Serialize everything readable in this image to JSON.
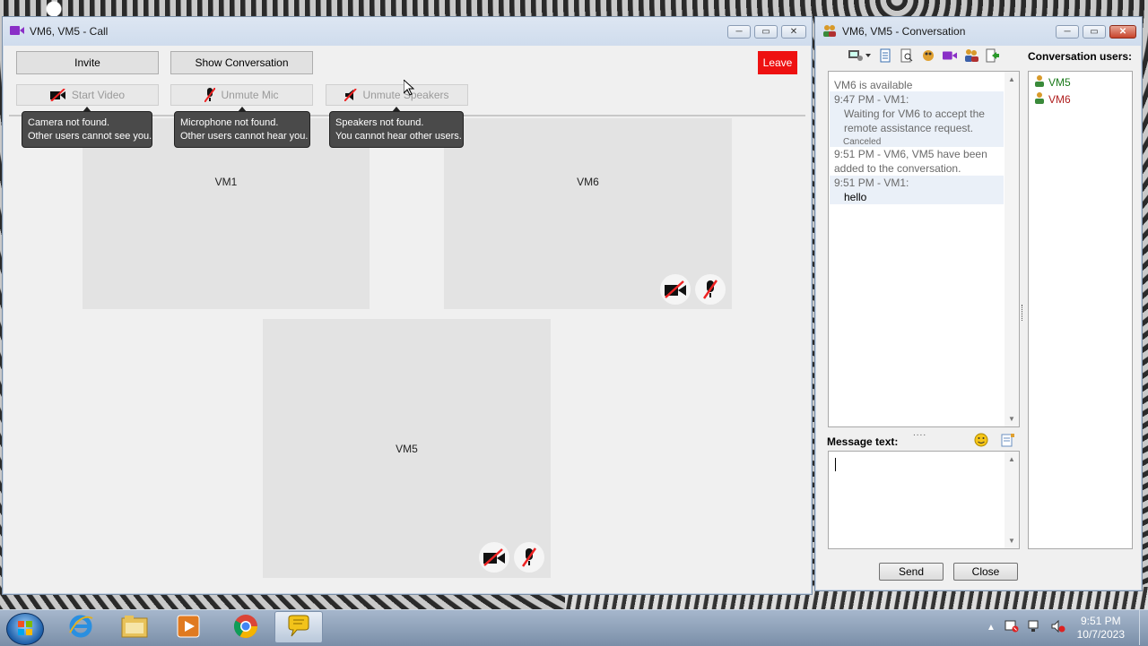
{
  "call_window": {
    "title": "VM6, VM5 - Call",
    "buttons": {
      "invite": "Invite",
      "show_conversation": "Show Conversation",
      "leave": "Leave",
      "start_video": "Start Video",
      "unmute_mic": "Unmute Mic",
      "unmute_speakers": "Unmute Speakers"
    },
    "tooltips": {
      "camera": [
        "Camera not found.",
        "Other users cannot see you."
      ],
      "microphone": [
        "Microphone not found.",
        "Other users cannot hear you."
      ],
      "speakers": [
        "Speakers not found.",
        "You cannot hear other users."
      ]
    },
    "participants": [
      {
        "name": "VM1",
        "show_status_icons": false
      },
      {
        "name": "VM6",
        "show_status_icons": true
      },
      {
        "name": "VM5",
        "show_status_icons": true
      }
    ]
  },
  "conversation_window": {
    "title": "VM6, VM5 - Conversation",
    "users_header": "Conversation users:",
    "users": [
      {
        "name": "VM5",
        "color": "#1a7a1a"
      },
      {
        "name": "VM6",
        "color": "#b02020"
      }
    ],
    "messages": {
      "m1": "VM6 is available",
      "m2_header": "9:47 PM - VM1:",
      "m2_body_1": "Waiting for VM6 to accept the",
      "m2_body_2": "remote assistance request.",
      "m2_status": "Canceled",
      "m3_1": "9:51 PM - VM6, VM5 have been",
      "m3_2": "added to the conversation.",
      "m4_header": "9:51 PM - VM1:",
      "m4_body": "hello"
    },
    "message_label": "Message text:",
    "message_value": "",
    "send": "Send",
    "close": "Close"
  },
  "taskbar": {
    "time": "9:51 PM",
    "date": "10/7/2023",
    "apps": [
      "internet-explorer",
      "file-explorer",
      "media-player",
      "chrome",
      "chat-app"
    ]
  },
  "colors": {
    "leave": "#ee1111",
    "tooltip_bg": "#4a4a4a",
    "tile_bg": "#e3e3e3"
  }
}
